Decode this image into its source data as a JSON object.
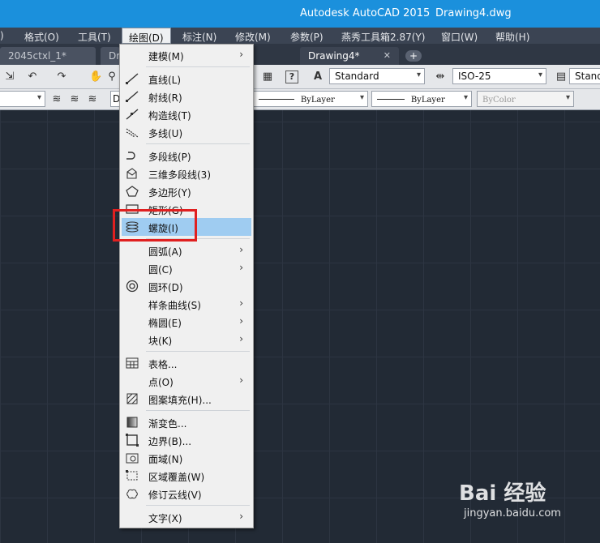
{
  "titlebar": {
    "app_title": "Autodesk AutoCAD 2015",
    "document": "Drawing4.dwg"
  },
  "menubar": {
    "items": [
      "格式(O)",
      "工具(T)",
      "绘图(D)",
      "标注(N)",
      "修改(M)",
      "参数(P)",
      "燕秀工具箱2.87(Y)",
      "窗口(W)",
      "帮助(H)"
    ]
  },
  "tabs": {
    "items": [
      "2045ctxl_1*",
      "Dr",
      "Drawing4*"
    ],
    "close_glyph": "✕",
    "new_tab_glyph": "+"
  },
  "toolbar": {
    "text_style": "Standard",
    "dim_style": "ISO-25",
    "table_style": "Stand",
    "linetype": "ByLayer",
    "lineweight": "ByLayer",
    "plot_style": "ByColor",
    "layer_cut": "D"
  },
  "draw_menu": {
    "items": [
      {
        "label": "建模(M)",
        "submenu": true,
        "icon": "none"
      },
      {
        "label": "直线(L)",
        "icon": "line-icon"
      },
      {
        "label": "射线(R)",
        "icon": "ray-icon"
      },
      {
        "label": "构造线(T)",
        "icon": "xline-icon"
      },
      {
        "label": "多线(U)",
        "icon": "mline-icon"
      },
      {
        "label": "多段线(P)",
        "icon": "polyline-icon"
      },
      {
        "label": "三维多段线(3)",
        "icon": "3dpoly-icon"
      },
      {
        "label": "多边形(Y)",
        "icon": "polygon-icon"
      },
      {
        "label": "矩形(G)",
        "icon": "rectangle-icon"
      },
      {
        "label": "螺旋(I)",
        "icon": "helix-icon",
        "highlighted": true
      },
      {
        "label": "圆弧(A)",
        "submenu": true
      },
      {
        "label": "圆(C)",
        "submenu": true
      },
      {
        "label": "圆环(D)",
        "icon": "donut-icon"
      },
      {
        "label": "样条曲线(S)",
        "submenu": true
      },
      {
        "label": "椭圆(E)",
        "submenu": true
      },
      {
        "label": "块(K)",
        "submenu": true
      },
      {
        "label": "表格...",
        "icon": "table-icon"
      },
      {
        "label": "点(O)",
        "submenu": true
      },
      {
        "label": "图案填充(H)...",
        "icon": "hatch-icon"
      },
      {
        "label": "渐变色...",
        "icon": "gradient-icon"
      },
      {
        "label": "边界(B)...",
        "icon": "boundary-icon"
      },
      {
        "label": "面域(N)",
        "icon": "region-icon"
      },
      {
        "label": "区域覆盖(W)",
        "icon": "wipeout-icon"
      },
      {
        "label": "修订云线(V)",
        "icon": "revcloud-icon"
      },
      {
        "label": "文字(X)",
        "submenu": true
      }
    ],
    "submenu_glyph": "›"
  },
  "watermark": {
    "brand": "Bai 经验",
    "url": "jingyan.baidu.com"
  },
  "colors": {
    "titlebar": "#1b90dc",
    "highlight": "#9fccf1",
    "callout": "#e02020",
    "canvas": "#222a35"
  }
}
